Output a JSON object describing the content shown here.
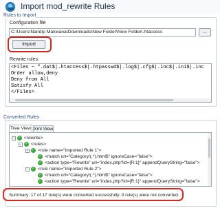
{
  "window": {
    "title": "Import mod_rewrite Rules"
  },
  "rules_to_import": {
    "group_label": "Rules to Import",
    "config_file_label": "Configuration file",
    "config_file_path": "C:\\Users\\Nandip Makwana\\Downloads\\New Folder\\New Folder\\.htaccess",
    "browse_label": "...",
    "import_label": "Import",
    "rewrite_rules_label": "Rewrite rules:",
    "rewrite_rules_text": "<Files ~ \".dat$|.htaccess$|.htpasswd$|.log$|.cfg$|.inc$|.ini$|.inc\nOrder allow,deny\nDeny from All\nSatisfy All\n</Files>"
  },
  "converted_rules": {
    "group_label": "Converted Rules",
    "tabs": [
      {
        "label": "Tree View",
        "active": true
      },
      {
        "label": "Xml View",
        "active": false
      }
    ],
    "tree": [
      {
        "expander": "−",
        "icon": "ok",
        "text": "<rewrite>"
      },
      {
        "expander": "−",
        "icon": "ok",
        "text": "<rules>"
      },
      {
        "expander": "−",
        "icon": "ok",
        "text": "<rule name=\"Imported Rule 1\">"
      },
      {
        "expander": "",
        "icon": "ok",
        "text": "<match url=\"Category/(.*).html$\" ignoreCase=\"false\">"
      },
      {
        "expander": "",
        "icon": "ok",
        "text": "<action type=\"Rewrite\" url=\"index.php?id={R:1}\" appendQueryString=\"false\">"
      },
      {
        "expander": "−",
        "icon": "ok",
        "text": "<rule name=\"Imported Rule 2\">"
      },
      {
        "expander": "",
        "icon": "ok",
        "text": "<match url=\"Category/(.*).html$\" ignoreCase=\"false\">"
      },
      {
        "expander": "",
        "icon": "ok",
        "text": "<action type=\"Rewrite\" url=\"index.php?id={R:1}\" appendQueryString=\"false\">"
      }
    ],
    "summary": "Summary: 17 of 17 rule(s) were converted successfully. 0 rule(s) were not converted."
  },
  "colors": {
    "highlight": "#d9261c",
    "success": "#3aa83a",
    "group_label": "#2a4f8a"
  },
  "icons": {
    "app": "import-rules-icon",
    "tree_ok": "green-check-icon",
    "expander": "collapse-toggle-icon"
  }
}
